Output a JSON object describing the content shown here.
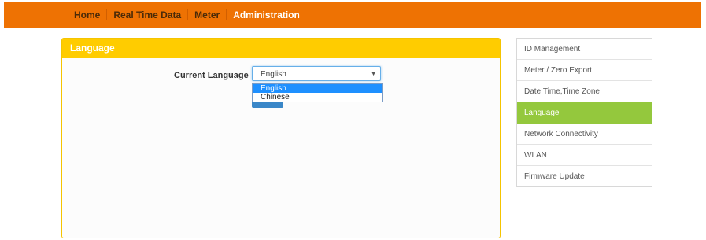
{
  "topnav": {
    "items": [
      {
        "label": "Home"
      },
      {
        "label": "Real Time Data"
      },
      {
        "label": "Meter"
      },
      {
        "label": "Administration",
        "active": true
      }
    ]
  },
  "panel": {
    "title": "Language",
    "language_label": "Current Language",
    "select_value": "English",
    "options": [
      "English",
      "Chinese"
    ],
    "selected_option": "English"
  },
  "sidebar": {
    "items": [
      {
        "label": "ID Management"
      },
      {
        "label": "Meter / Zero Export"
      },
      {
        "label": "Date,Time,Time Zone"
      },
      {
        "label": "Language",
        "active": true
      },
      {
        "label": "Network Connectivity"
      },
      {
        "label": "WLAN"
      },
      {
        "label": "Firmware Update"
      }
    ]
  },
  "colors": {
    "topbar": "#ee7203",
    "panel_header": "#ffcc00",
    "sidebar_active": "#94c83d",
    "dropdown_highlight": "#1e90ff"
  }
}
